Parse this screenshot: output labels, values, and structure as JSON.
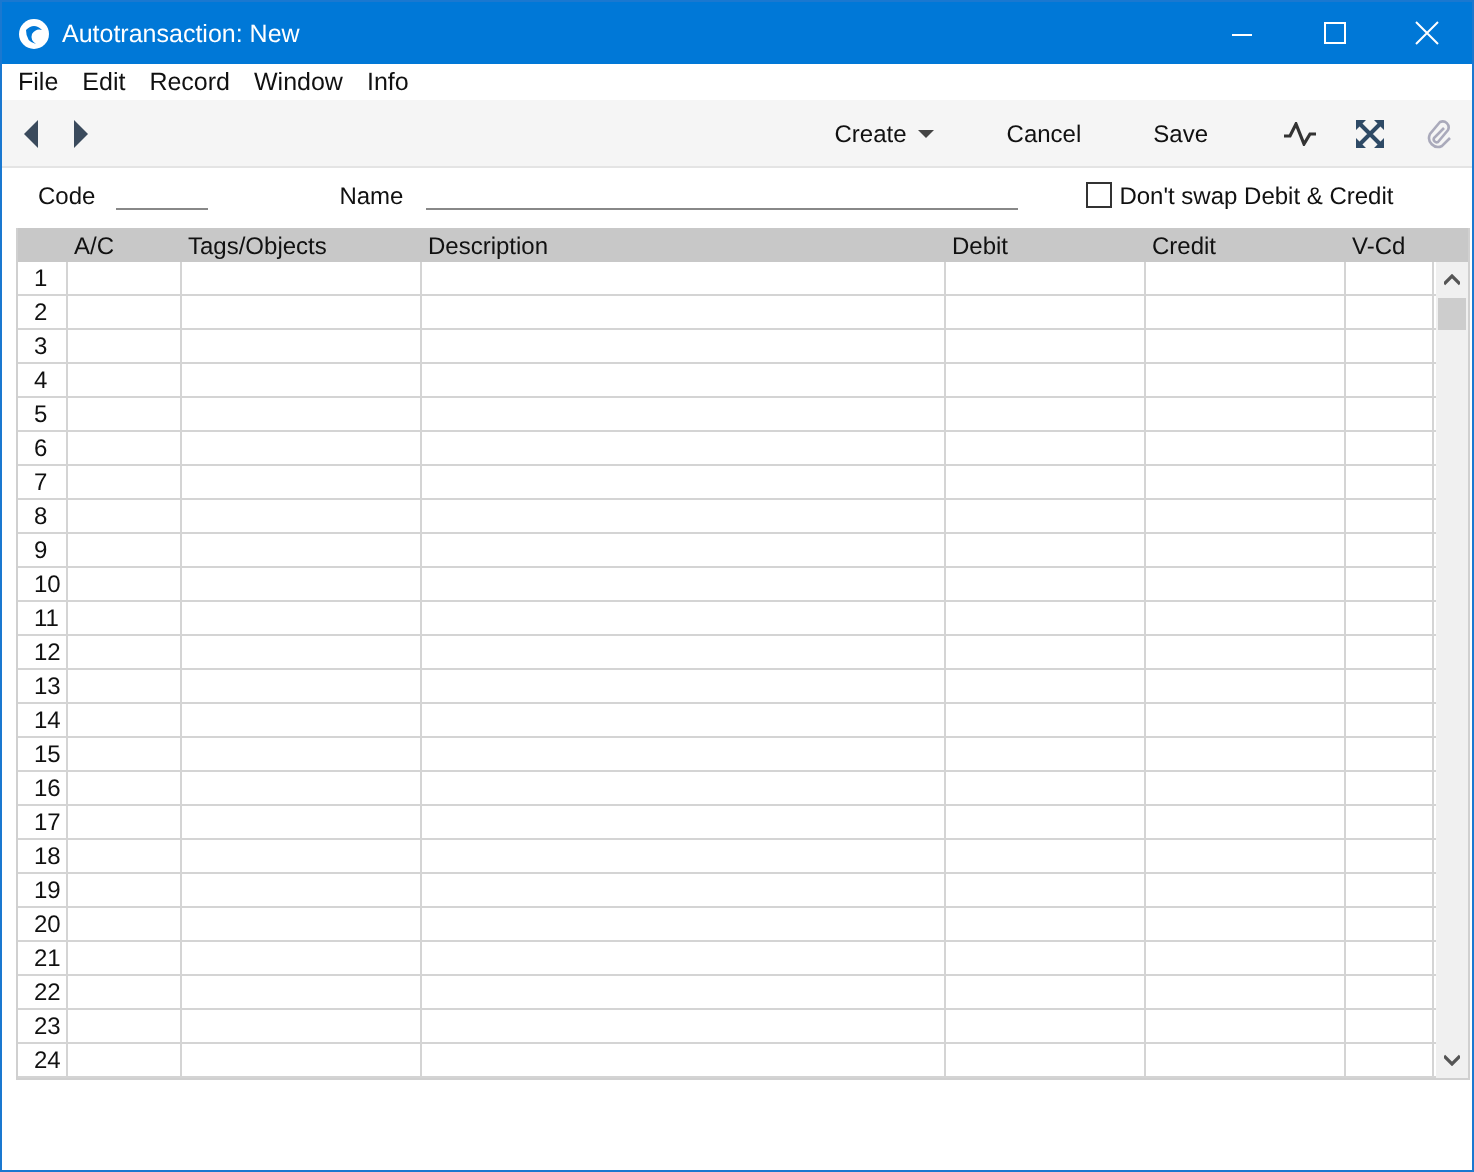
{
  "window": {
    "title": "Autotransaction: New"
  },
  "menu": [
    "File",
    "Edit",
    "Record",
    "Window",
    "Info"
  ],
  "toolbar": {
    "buttons": [
      {
        "label": "Create",
        "kind": "dropdown"
      },
      {
        "label": "Cancel",
        "kind": "plain"
      },
      {
        "label": "Save",
        "kind": "plain"
      }
    ],
    "attachment_disabled": true
  },
  "form": {
    "code_label": "Code",
    "name_label": "Name",
    "swap_checkbox": {
      "label": "Don't swap Debit & Credit",
      "checked": false
    }
  },
  "table": {
    "columns": [
      "A/C",
      "Tags/Objects",
      "Description",
      "Debit",
      "Credit",
      "V-Cd"
    ],
    "rows": [
      "1",
      "2",
      "3",
      "4",
      "5",
      "6",
      "7",
      "8",
      "9",
      "10",
      "11",
      "12",
      "13",
      "14",
      "15",
      "16",
      "17",
      "18",
      "19",
      "20",
      "21",
      "22",
      "23",
      "24"
    ]
  }
}
